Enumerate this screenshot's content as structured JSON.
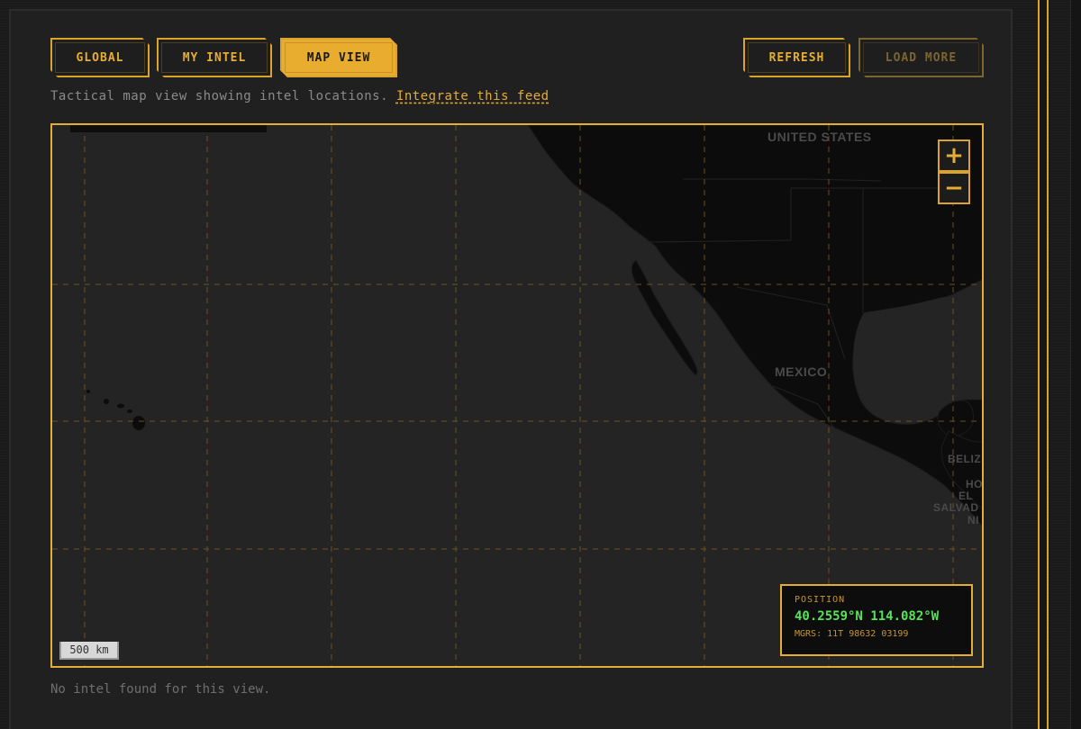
{
  "tabs": [
    {
      "label": "GLOBAL",
      "active": false
    },
    {
      "label": "MY INTEL",
      "active": false
    },
    {
      "label": "MAP VIEW",
      "active": true
    }
  ],
  "actions": {
    "refresh_label": "REFRESH",
    "load_more_label": "LOAD MORE"
  },
  "subtitle": {
    "text": "Tactical map view showing intel locations.",
    "link_text": "Integrate this feed"
  },
  "map": {
    "labels": {
      "united_states": "UNITED STATES",
      "mexico": "MEXICO",
      "belize": "BELIZ",
      "honduras": "HO",
      "el": "EL",
      "salvador": "SALVAD",
      "ni": "NI"
    },
    "zoom_in": "+",
    "zoom_out": "−",
    "scale": "500 km",
    "position": {
      "label": "POSITION",
      "coords": "40.2559°N 114.082°W",
      "mgrs": "MGRS: 11T 98632 03199"
    }
  },
  "empty_message": "No intel found for this view.",
  "colors": {
    "accent": "#e5ad32",
    "coords": "#58e25a",
    "land": "#0c0c0c",
    "ocean": "#242424"
  }
}
